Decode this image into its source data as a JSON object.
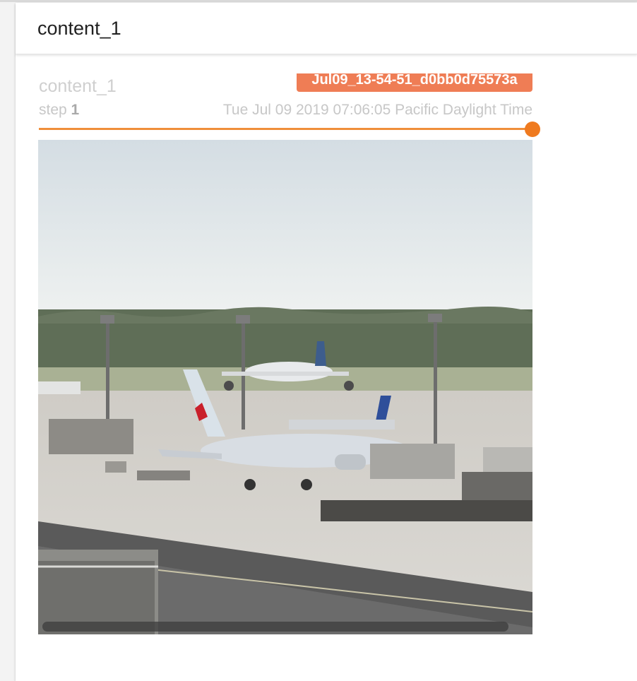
{
  "card": {
    "title": "content_1"
  },
  "image_panel": {
    "tag": "content_1",
    "run": "Jul09_13-54-51_d0bb0d75573a",
    "step_label": "step",
    "step_value": "1",
    "timestamp": "Tue Jul 09 2019 07:06:05 Pacific Daylight Time",
    "slider_value": 1.0,
    "image_alt": "airport apron with parked airplanes"
  },
  "colors": {
    "accent": "#ef7a1f",
    "run_badge": "#ef7d55"
  }
}
